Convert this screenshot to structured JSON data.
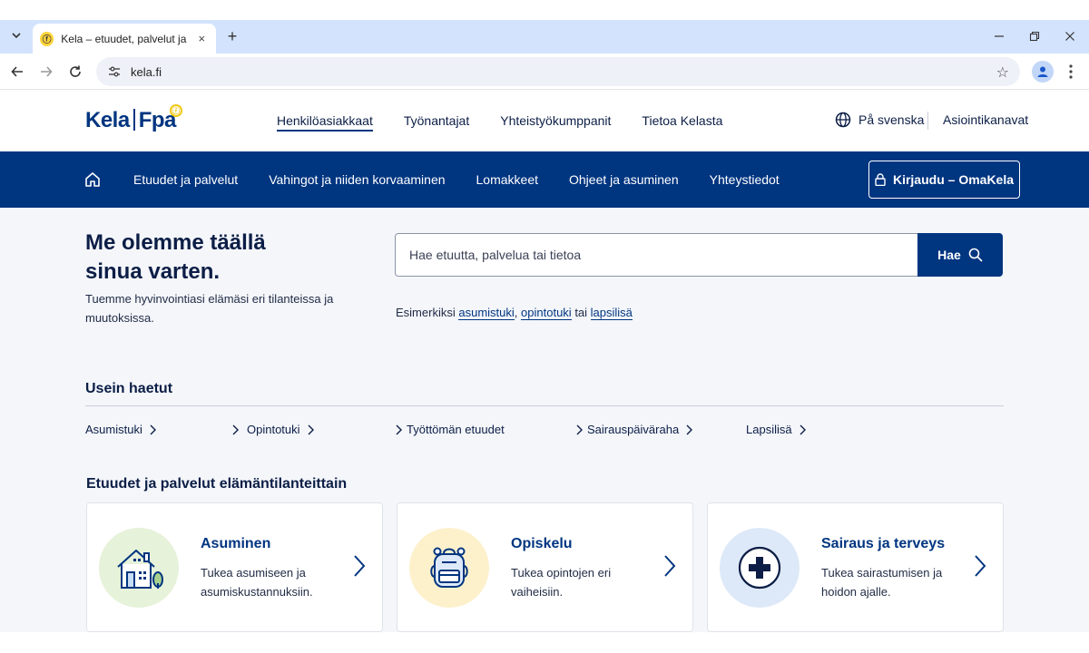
{
  "browser": {
    "tab_title": "Kela – etuudet, palvelut ja tuki a",
    "tab_favicon": "Fpa",
    "url": "kela.fi",
    "new_tab": "+",
    "tab_close": "×"
  },
  "header": {
    "logo_kela": "Kela",
    "logo_fpa": "Fpa",
    "top_nav": [
      "Henkilöasiakkaat",
      "Työnantajat",
      "Yhteistyökumppanit",
      "Tietoa Kelasta"
    ],
    "language": "På svenska",
    "channels": "Asiointikanavat"
  },
  "main_nav": {
    "items": [
      "Etuudet ja palvelut",
      "Vahingot ja niiden korvaaminen",
      "Lomakkeet",
      "Ohjeet ja asuminen",
      "Yhteystiedot"
    ],
    "login": "Kirjaudu – OmaKela"
  },
  "hero": {
    "title": "Me olemme täällä sinua varten.",
    "subtitle": "Tuemme hyvinvointiasi elämäsi eri tilanteissa ja muutoksissa."
  },
  "search": {
    "placeholder": "Hae etuutta, palvelua tai tietoa",
    "button": "Hae",
    "examples_prefix": "Esimerkiksi",
    "example_1": "asumistuki",
    "comma": ",",
    "example_2": "opintotuki",
    "separator": "tai",
    "example_3": "lapsilisä"
  },
  "frequent": {
    "title": "Usein haetut",
    "links": [
      "Asumistuki",
      "Opintotuki",
      "Työttömän etuudet",
      "Sairauspäiväraha",
      "Lapsilisä"
    ]
  },
  "life_situations": {
    "title": "Etuudet ja palvelut elämäntilanteittain",
    "cards": [
      {
        "title": "Asuminen",
        "desc": "Tukea asumiseen ja asumiskustannuksiin.",
        "icon": "house-icon",
        "color": "#e6f2d9"
      },
      {
        "title": "Opiskelu",
        "desc": "Tukea opintojen eri vaiheisiin.",
        "icon": "backpack-icon",
        "color": "#fdf1cc"
      },
      {
        "title": "Sairaus ja terveys",
        "desc": "Tukea sairastumisen ja hoidon ajalle.",
        "icon": "health-cross-icon",
        "color": "#dde9f8"
      }
    ]
  },
  "colors": {
    "brand": "#003580",
    "accent": "#f2c811"
  }
}
